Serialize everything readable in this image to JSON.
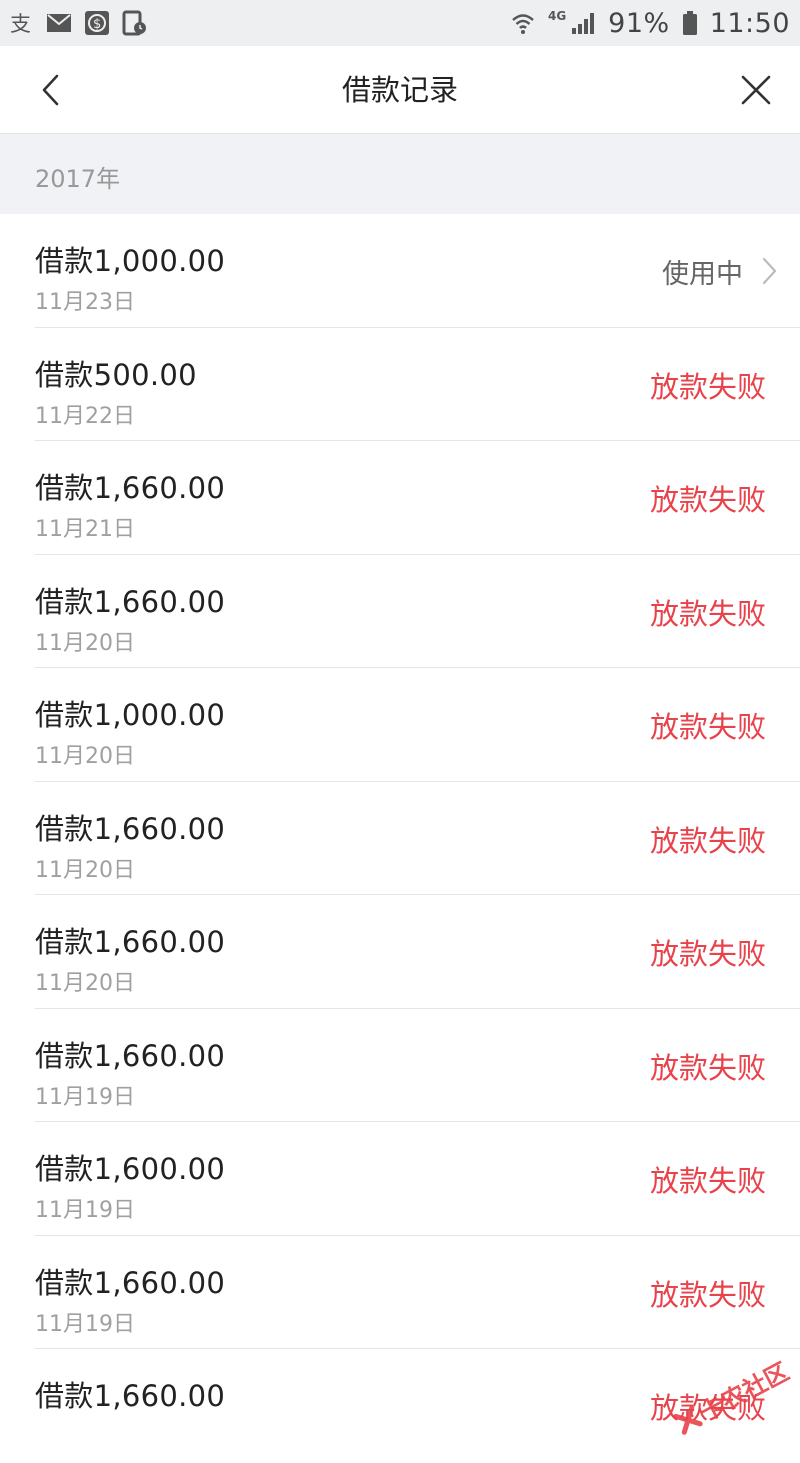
{
  "statusbar": {
    "icons_left": [
      "alipay-icon",
      "mail-icon",
      "money-icon",
      "tablet-clock-icon"
    ],
    "network": "4G",
    "battery": "91%",
    "time": "11:50"
  },
  "nav": {
    "title": "借款记录"
  },
  "section": {
    "year": "2017年"
  },
  "records": [
    {
      "title": "借款1,000.00",
      "date": "11月23日",
      "status": "使用中",
      "type": "using"
    },
    {
      "title": "借款500.00",
      "date": "11月22日",
      "status": "放款失败",
      "type": "fail"
    },
    {
      "title": "借款1,660.00",
      "date": "11月21日",
      "status": "放款失败",
      "type": "fail"
    },
    {
      "title": "借款1,660.00",
      "date": "11月20日",
      "status": "放款失败",
      "type": "fail"
    },
    {
      "title": "借款1,000.00",
      "date": "11月20日",
      "status": "放款失败",
      "type": "fail"
    },
    {
      "title": "借款1,660.00",
      "date": "11月20日",
      "status": "放款失败",
      "type": "fail"
    },
    {
      "title": "借款1,660.00",
      "date": "11月20日",
      "status": "放款失败",
      "type": "fail"
    },
    {
      "title": "借款1,660.00",
      "date": "11月19日",
      "status": "放款失败",
      "type": "fail"
    },
    {
      "title": "借款1,600.00",
      "date": "11月19日",
      "status": "放款失败",
      "type": "fail"
    },
    {
      "title": "借款1,660.00",
      "date": "11月19日",
      "status": "放款失败",
      "type": "fail"
    },
    {
      "title": "借款1,660.00",
      "date": "",
      "status": "放款失败",
      "type": "fail"
    }
  ],
  "watermark": {
    "text": "卡农社区"
  },
  "colors": {
    "fail": "#e8434b",
    "accent_bg": "#f1f2f5"
  }
}
